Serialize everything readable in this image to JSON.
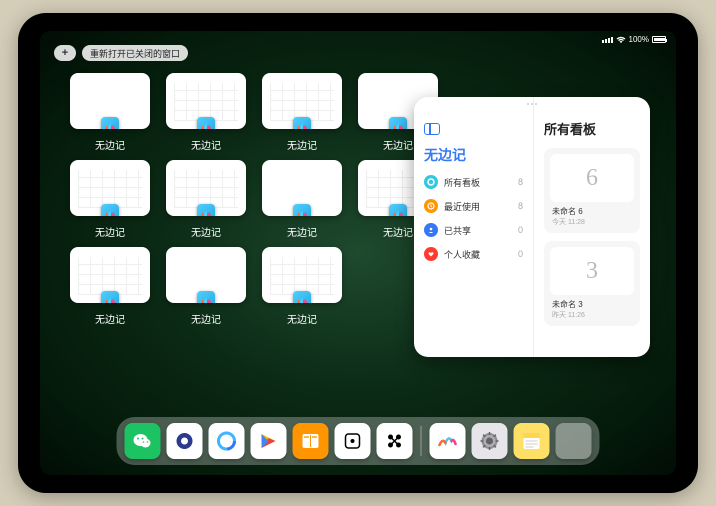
{
  "status": {
    "battery_percent": "100%"
  },
  "top": {
    "plus_label": "+",
    "reopen_label": "重新打开已关闭的窗口"
  },
  "app_name": "无边记",
  "windows": [
    {
      "label": "无边记",
      "style": "blank"
    },
    {
      "label": "无边记",
      "style": "grid"
    },
    {
      "label": "无边记",
      "style": "grid"
    },
    {
      "label": "无边记",
      "style": "blank"
    },
    {
      "label": "无边记",
      "style": "grid"
    },
    {
      "label": "无边记",
      "style": "grid"
    },
    {
      "label": "无边记",
      "style": "blank"
    },
    {
      "label": "无边记",
      "style": "grid"
    },
    {
      "label": "无边记",
      "style": "grid"
    },
    {
      "label": "无边记",
      "style": "blank"
    },
    {
      "label": "无边记",
      "style": "grid"
    }
  ],
  "panel": {
    "sidebar_title": "无边记",
    "items": [
      {
        "icon_color": "#34c8e0",
        "label": "所有看板",
        "count": "8",
        "kind": "circle"
      },
      {
        "icon_color": "#ff9500",
        "label": "最近使用",
        "count": "8",
        "kind": "clock"
      },
      {
        "icon_color": "#3478f6",
        "label": "已共享",
        "count": "0",
        "kind": "person"
      },
      {
        "icon_color": "#ff3b30",
        "label": "个人收藏",
        "count": "0",
        "kind": "heart"
      }
    ],
    "main_title": "所有看板",
    "boards": [
      {
        "glyph": "6",
        "name": "未命名 6",
        "time": "今天 11:28"
      },
      {
        "glyph": "3",
        "name": "未命名 3",
        "time": "昨天 11:26"
      }
    ]
  },
  "dock": {
    "apps": [
      {
        "name": "wechat",
        "bg": "#1dc362"
      },
      {
        "name": "quark",
        "bg": "#ffffff"
      },
      {
        "name": "qq-browser",
        "bg": "#ffffff"
      },
      {
        "name": "play",
        "bg": "#ffffff"
      },
      {
        "name": "books",
        "bg": "#ff9500"
      },
      {
        "name": "dice",
        "bg": "#ffffff"
      },
      {
        "name": "connect",
        "bg": "#ffffff"
      }
    ],
    "recent": [
      {
        "name": "freeform",
        "bg": "#ffffff"
      },
      {
        "name": "settings",
        "bg": "#e5e5ea"
      },
      {
        "name": "notes",
        "bg": "#ffe066"
      }
    ],
    "folder_colors": [
      "#3fc8ff",
      "#ff8a3d",
      "#3478f6",
      "#28c840"
    ]
  }
}
